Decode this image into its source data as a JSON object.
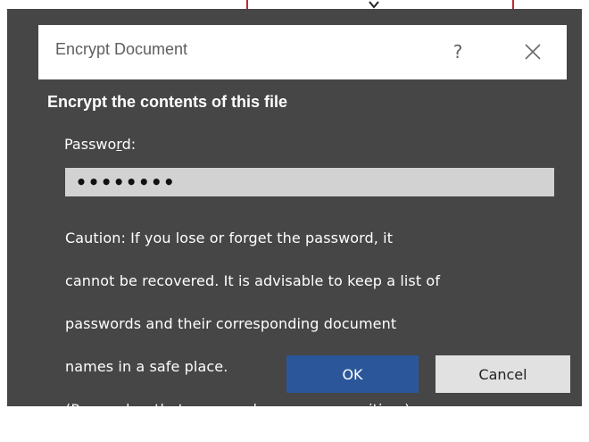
{
  "dialog": {
    "title": "Encrypt Document",
    "help_glyph": "?",
    "close_icon": "close-icon",
    "heading": "Encrypt the contents of this file",
    "password_label_prefix": "Passwo",
    "password_label_accel": "r",
    "password_label_suffix": "d:",
    "password_value": "••••••••",
    "caution_lines": [
      "Caution: If you lose or forget the password, it",
      "cannot be recovered. It is advisable to keep a list of",
      "passwords and their corresponding document",
      "names in a safe place.",
      "(Remember that passwords are case-sensitive.)"
    ],
    "ok_label": "OK",
    "cancel_label": "Cancel"
  },
  "colors": {
    "dialog_bg": "#464646",
    "titlebar_bg": "#ffffff",
    "primary_button": "#2b579a",
    "secondary_button": "#e1e1e1",
    "input_bg": "#d2d2d2",
    "background_highlight": "#c0282c"
  }
}
